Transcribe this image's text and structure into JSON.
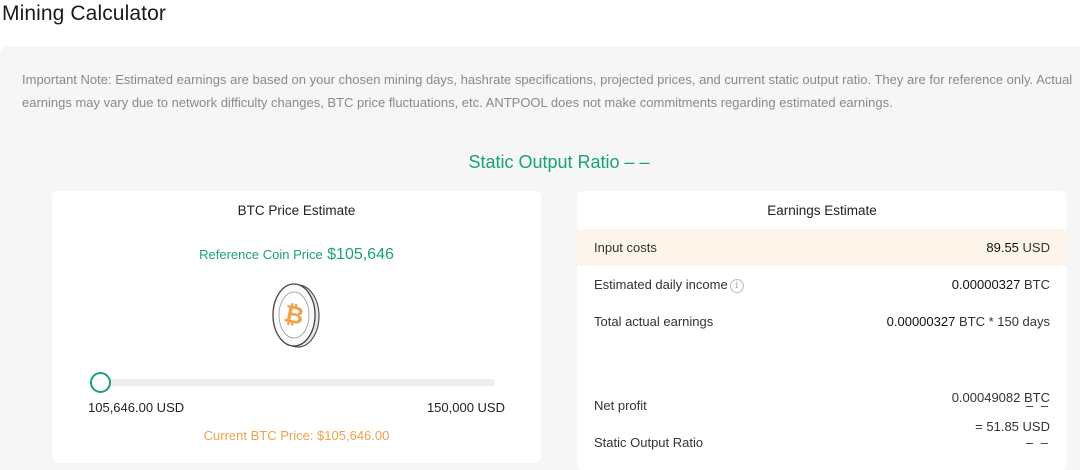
{
  "page": {
    "title": "Mining Calculator"
  },
  "note": "Important Note: Estimated earnings are based on your chosen mining days, hashrate specifications, projected prices, and current static output ratio. They are for reference only. Actual earnings may vary due to network difficulty changes, BTC price fluctuations, etc. ANTPOOL does not make commitments regarding estimated earnings.",
  "ratio_title": "Static Output Ratio – –",
  "price_card": {
    "title": "BTC Price Estimate",
    "ref_label": "Reference Coin Price",
    "ref_value": "$105,646",
    "slider": {
      "min_label": "105,646.00 USD",
      "max_label": "150,000 USD",
      "level": 0
    },
    "current_price": "Current BTC Price: $105,646.00",
    "coin_icon": "bitcoin-coin-icon"
  },
  "earnings_card": {
    "title": "Earnings Estimate",
    "input_costs": {
      "label": "Input costs",
      "value": "89.55",
      "unit": "USD"
    },
    "daily_income": {
      "label": "Estimated daily income",
      "value": "0.00000327",
      "unit": "BTC",
      "icon": "info-icon"
    },
    "total_earnings": {
      "label": "Total actual earnings",
      "line1_value": "0.00000327",
      "line1_unit": "BTC * 150 days",
      "line2_value": "0.00049082",
      "line2_unit": "BTC",
      "line3_value": "= 51.85",
      "line3_unit": "USD"
    },
    "net_profit": {
      "label": "Net profit",
      "value": "– –"
    },
    "static_ratio": {
      "label": "Static Output Ratio",
      "value": "– –"
    }
  },
  "colors": {
    "accent_green": "#1aa179",
    "price_orange": "#f0a24b",
    "highlight_row": "#fdf4ea"
  }
}
